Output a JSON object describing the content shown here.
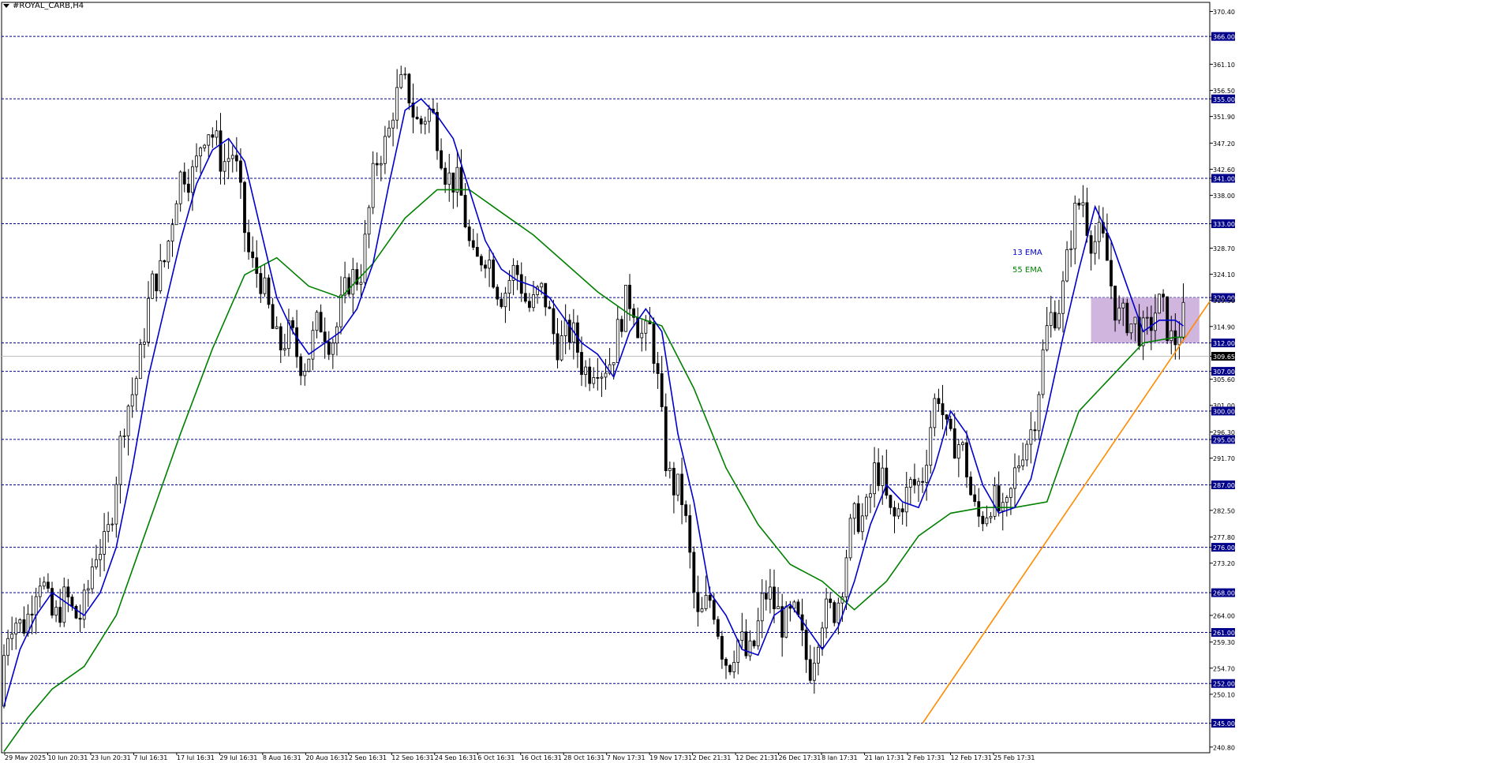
{
  "symbol_title": "#ROYAL_CARB,H4",
  "colors": {
    "background": "#ffffff",
    "candle": "#000000",
    "level_line": "#00008b",
    "ema13": "#0000cc",
    "ema55": "#008000",
    "trendline": "#ff8c00",
    "zone": "#c8a8d8",
    "price_line": "#c0c0c0"
  },
  "chart_data": {
    "type": "candlestick",
    "title": "#ROYAL_CARB,H4",
    "ylim": [
      239.8,
      372.0
    ],
    "grid": false,
    "y_ticks": [
      "370.40",
      "366.00",
      "361.10",
      "356.50",
      "355.00",
      "351.90",
      "347.20",
      "342.60",
      "341.00",
      "338.00",
      "333.00",
      "328.70",
      "324.10",
      "320.00",
      "319.50",
      "314.90",
      "312.00",
      "309.65",
      "307.00",
      "305.60",
      "301.00",
      "300.00",
      "296.30",
      "295.00",
      "291.70",
      "287.00",
      "282.50",
      "277.80",
      "276.00",
      "273.20",
      "268.00",
      "264.00",
      "261.00",
      "259.30",
      "254.70",
      "252.00",
      "250.10",
      "245.00",
      "240.80"
    ],
    "x_labels": [
      "29 May 2025",
      "10 Jun 20:31",
      "23 Jun 20:31",
      "7 Jul 16:31",
      "17 Jul 16:31",
      "29 Jul 16:31",
      "8 Aug 16:31",
      "20 Aug 16:31",
      "2 Sep 16:31",
      "12 Sep 16:31",
      "24 Sep 16:31",
      "6 Oct 16:31",
      "16 Oct 16:31",
      "28 Oct 16:31",
      "7 Nov 17:31",
      "19 Nov 17:31",
      "2 Dec 21:31",
      "12 Dec 21:31",
      "26 Dec 17:31",
      "8 Jan 17:31",
      "21 Jan 17:31",
      "2 Feb 17:31",
      "12 Feb 17:31",
      "25 Feb 17:31"
    ],
    "horizontal_levels": [
      366,
      355,
      341,
      333,
      320,
      312,
      307,
      300,
      295,
      287,
      276,
      268,
      261,
      252,
      245
    ],
    "current_price": 309.65,
    "supply_zone": {
      "from": 312,
      "to": 320,
      "start_label": "21 Jan 17:31"
    },
    "trendline": {
      "from": {
        "date": "2 Dec 21:31",
        "price": 245
      },
      "to_price": 319.3
    },
    "series": [
      {
        "name": "13 EMA",
        "points": [
          [
            0,
            248
          ],
          [
            4,
            258
          ],
          [
            8,
            264
          ],
          [
            12,
            268
          ],
          [
            16,
            266
          ],
          [
            20,
            264
          ],
          [
            24,
            268
          ],
          [
            28,
            276
          ],
          [
            32,
            290
          ],
          [
            36,
            306
          ],
          [
            40,
            318
          ],
          [
            44,
            330
          ],
          [
            48,
            340
          ],
          [
            52,
            346
          ],
          [
            56,
            348
          ],
          [
            60,
            344
          ],
          [
            64,
            332
          ],
          [
            68,
            320
          ],
          [
            72,
            314
          ],
          [
            76,
            310
          ],
          [
            80,
            312
          ],
          [
            84,
            314
          ],
          [
            88,
            318
          ],
          [
            92,
            326
          ],
          [
            96,
            340
          ],
          [
            100,
            353
          ],
          [
            104,
            355
          ],
          [
            108,
            352
          ],
          [
            112,
            348
          ],
          [
            116,
            339
          ],
          [
            120,
            330
          ],
          [
            124,
            325
          ],
          [
            128,
            323
          ],
          [
            132,
            322
          ],
          [
            136,
            320
          ],
          [
            140,
            316
          ],
          [
            144,
            312
          ],
          [
            148,
            310
          ],
          [
            152,
            306
          ],
          [
            156,
            314
          ],
          [
            160,
            318
          ],
          [
            164,
            314
          ],
          [
            168,
            296
          ],
          [
            172,
            284
          ],
          [
            176,
            268
          ],
          [
            180,
            264
          ],
          [
            184,
            258
          ],
          [
            188,
            257
          ],
          [
            192,
            264
          ],
          [
            196,
            266
          ],
          [
            200,
            262
          ],
          [
            204,
            258
          ],
          [
            208,
            262
          ],
          [
            212,
            270
          ],
          [
            216,
            280
          ],
          [
            220,
            287
          ],
          [
            224,
            284
          ],
          [
            228,
            283
          ],
          [
            232,
            290
          ],
          [
            236,
            300
          ],
          [
            240,
            296
          ],
          [
            244,
            287
          ],
          [
            248,
            282
          ],
          [
            252,
            283
          ],
          [
            256,
            288
          ],
          [
            260,
            300
          ],
          [
            264,
            313
          ],
          [
            268,
            325
          ],
          [
            272,
            336
          ],
          [
            276,
            330
          ],
          [
            280,
            322
          ],
          [
            284,
            314
          ],
          [
            288,
            316
          ],
          [
            292,
            316
          ],
          [
            294,
            315
          ]
        ]
      },
      {
        "name": "55 EMA",
        "points": [
          [
            0,
            240
          ],
          [
            6,
            246
          ],
          [
            12,
            251
          ],
          [
            20,
            255
          ],
          [
            28,
            264
          ],
          [
            36,
            280
          ],
          [
            44,
            296
          ],
          [
            52,
            311
          ],
          [
            60,
            324
          ],
          [
            68,
            327
          ],
          [
            76,
            322
          ],
          [
            84,
            320
          ],
          [
            92,
            326
          ],
          [
            100,
            334
          ],
          [
            108,
            339
          ],
          [
            116,
            339
          ],
          [
            124,
            335
          ],
          [
            132,
            331
          ],
          [
            140,
            326
          ],
          [
            148,
            321
          ],
          [
            156,
            317
          ],
          [
            164,
            315
          ],
          [
            172,
            304
          ],
          [
            180,
            290
          ],
          [
            188,
            280
          ],
          [
            196,
            273
          ],
          [
            204,
            270
          ],
          [
            212,
            265
          ],
          [
            220,
            270
          ],
          [
            228,
            278
          ],
          [
            236,
            282
          ],
          [
            244,
            283
          ],
          [
            252,
            283
          ],
          [
            260,
            284
          ],
          [
            268,
            300
          ],
          [
            276,
            306
          ],
          [
            284,
            312
          ],
          [
            292,
            313
          ],
          [
            294,
            313
          ]
        ]
      }
    ]
  },
  "labels": {
    "ema13_label": "13 EMA",
    "ema55_label": "55 EMA"
  }
}
